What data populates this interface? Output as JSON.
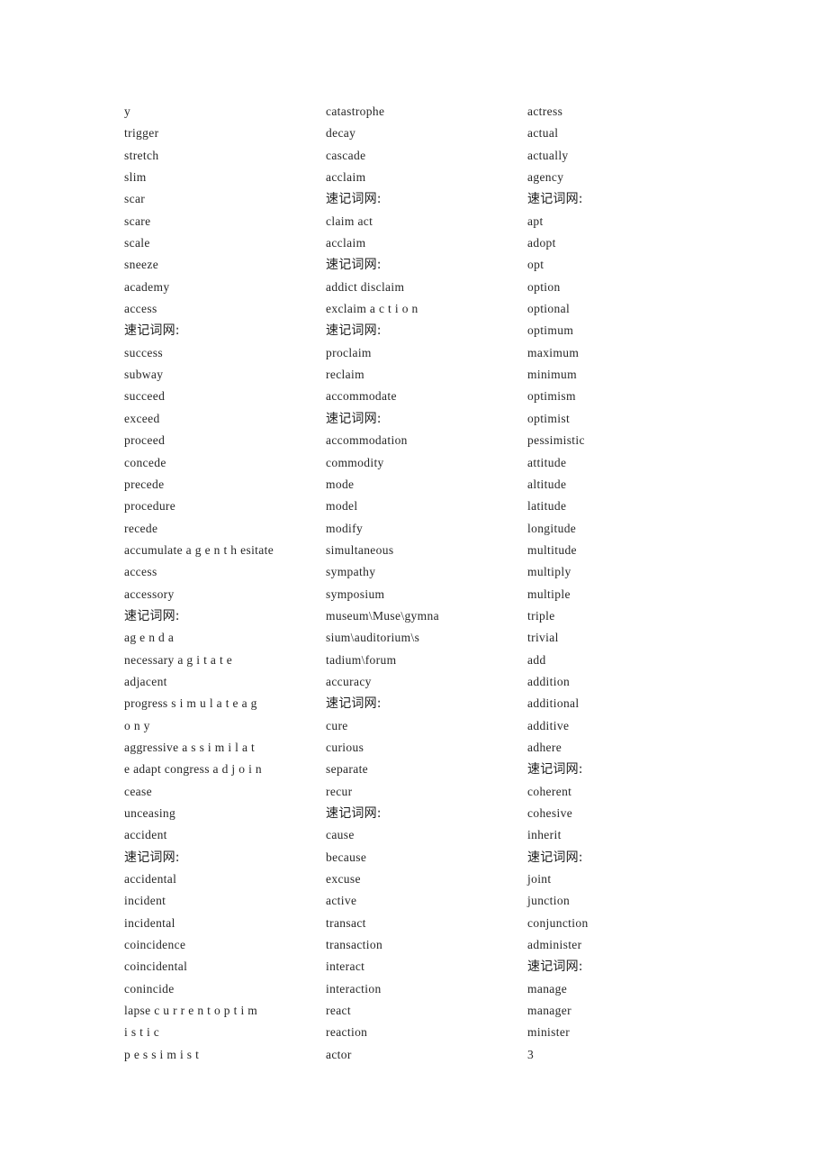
{
  "document": {
    "page_number": "3",
    "shorthand_label": "速记词网:",
    "columns": [
      {
        "name": "column-1",
        "lines": [
          {
            "text": "y",
            "type": "word"
          },
          {
            "text": "trigger",
            "type": "word"
          },
          {
            "text": "stretch",
            "type": "word"
          },
          {
            "text": "slim",
            "type": "word"
          },
          {
            "text": "scar",
            "type": "word"
          },
          {
            "text": "scare",
            "type": "word"
          },
          {
            "text": "scale",
            "type": "word"
          },
          {
            "text": "sneeze",
            "type": "word"
          },
          {
            "text": "academy",
            "type": "word"
          },
          {
            "text": "access",
            "type": "word"
          },
          {
            "text": "速记词网:",
            "type": "cn"
          },
          {
            "text": "success",
            "type": "word"
          },
          {
            "text": "subway",
            "type": "word"
          },
          {
            "text": "succeed",
            "type": "word"
          },
          {
            "text": "exceed",
            "type": "word"
          },
          {
            "text": "proceed",
            "type": "word"
          },
          {
            "text": "concede",
            "type": "word"
          },
          {
            "text": "precede",
            "type": "word"
          },
          {
            "text": "procedure",
            "type": "word"
          },
          {
            "text": "recede",
            "type": "word"
          },
          {
            "text": "accumulate a g e n t h esitate",
            "type": "spread"
          },
          {
            "text": "access",
            "type": "word"
          },
          {
            "text": "accessory",
            "type": "word"
          },
          {
            "text": "速记词网:",
            "type": "cn"
          },
          {
            "text": "ag e n d a",
            "type": "spread"
          },
          {
            "text": "necessary a g i t a t e",
            "type": "spread"
          },
          {
            "text": "adjacent",
            "type": "word"
          },
          {
            "text": "progress s i m u l a t e a g",
            "type": "spread"
          },
          {
            "text": "o n y",
            "type": "spread"
          },
          {
            "text": "aggressive a s s i m i l a t",
            "type": "spread"
          },
          {
            "text": "e adapt congress a d j o i n",
            "type": "spread"
          },
          {
            "text": "cease",
            "type": "word"
          },
          {
            "text": "unceasing",
            "type": "word"
          },
          {
            "text": "accident",
            "type": "word"
          },
          {
            "text": "速记词网:",
            "type": "cn"
          },
          {
            "text": "accidental",
            "type": "word"
          },
          {
            "text": "incident",
            "type": "word"
          },
          {
            "text": "incidental",
            "type": "word"
          },
          {
            "text": "coincidence",
            "type": "word"
          },
          {
            "text": "coincidental",
            "type": "word"
          },
          {
            "text": "conincide",
            "type": "word"
          },
          {
            "text": "lapse c u r r e n t o p t i m",
            "type": "spread"
          },
          {
            "text": "i s t i c",
            "type": "spread"
          },
          {
            "text": "p e s s i m i s t",
            "type": "spread"
          }
        ]
      },
      {
        "name": "column-2",
        "lines": [
          {
            "text": "catastrophe",
            "type": "word"
          },
          {
            "text": "decay",
            "type": "word"
          },
          {
            "text": "cascade",
            "type": "word"
          },
          {
            "text": "acclaim",
            "type": "word"
          },
          {
            "text": "速记词网:",
            "type": "cn"
          },
          {
            "text": "claim act",
            "type": "word"
          },
          {
            "text": "acclaim",
            "type": "word"
          },
          {
            "text": "速记词网:",
            "type": "cn"
          },
          {
            "text": "addict disclaim",
            "type": "word"
          },
          {
            "text": "exclaim a c t i o n",
            "type": "spread"
          },
          {
            "text": "速记词网:",
            "type": "cn"
          },
          {
            "text": "proclaim",
            "type": "word"
          },
          {
            "text": "reclaim",
            "type": "word"
          },
          {
            "text": "accommodate",
            "type": "word"
          },
          {
            "text": "速记词网:",
            "type": "cn"
          },
          {
            "text": "accommodation",
            "type": "word"
          },
          {
            "text": "commodity",
            "type": "word"
          },
          {
            "text": "mode",
            "type": "word"
          },
          {
            "text": "model",
            "type": "word"
          },
          {
            "text": "modify",
            "type": "word"
          },
          {
            "text": "simultaneous",
            "type": "word"
          },
          {
            "text": "sympathy",
            "type": "word"
          },
          {
            "text": "symposium",
            "type": "word"
          },
          {
            "text": "museum\\Muse\\gymna",
            "type": "word"
          },
          {
            "text": "sium\\auditorium\\s",
            "type": "word"
          },
          {
            "text": "tadium\\forum",
            "type": "word"
          },
          {
            "text": "accuracy",
            "type": "word"
          },
          {
            "text": "速记词网:",
            "type": "cn"
          },
          {
            "text": "cure",
            "type": "word"
          },
          {
            "text": "curious",
            "type": "word"
          },
          {
            "text": "separate",
            "type": "word"
          },
          {
            "text": "recur",
            "type": "word"
          },
          {
            "text": "速记词网:",
            "type": "cn"
          },
          {
            "text": "cause",
            "type": "word"
          },
          {
            "text": "because",
            "type": "word"
          },
          {
            "text": "excuse",
            "type": "word"
          },
          {
            "text": "active",
            "type": "word"
          },
          {
            "text": "transact",
            "type": "word"
          },
          {
            "text": "transaction",
            "type": "word"
          },
          {
            "text": "interact",
            "type": "word"
          },
          {
            "text": "interaction",
            "type": "word"
          },
          {
            "text": "react",
            "type": "word"
          },
          {
            "text": "reaction",
            "type": "word"
          },
          {
            "text": "actor",
            "type": "word"
          }
        ]
      },
      {
        "name": "column-3",
        "lines": [
          {
            "text": "actress",
            "type": "word"
          },
          {
            "text": "actual",
            "type": "word"
          },
          {
            "text": "actually",
            "type": "word"
          },
          {
            "text": "agency",
            "type": "word"
          },
          {
            "text": "速记词网:",
            "type": "cn"
          },
          {
            "text": "apt",
            "type": "word"
          },
          {
            "text": "adopt",
            "type": "word"
          },
          {
            "text": "opt",
            "type": "word"
          },
          {
            "text": "option",
            "type": "word"
          },
          {
            "text": "optional",
            "type": "word"
          },
          {
            "text": "optimum",
            "type": "word"
          },
          {
            "text": "maximum",
            "type": "word"
          },
          {
            "text": "minimum",
            "type": "word"
          },
          {
            "text": "optimism",
            "type": "word"
          },
          {
            "text": "optimist",
            "type": "word"
          },
          {
            "text": "pessimistic",
            "type": "word"
          },
          {
            "text": "attitude",
            "type": "word"
          },
          {
            "text": "altitude",
            "type": "word"
          },
          {
            "text": "latitude",
            "type": "word"
          },
          {
            "text": "longitude",
            "type": "word"
          },
          {
            "text": "multitude",
            "type": "word"
          },
          {
            "text": "multiply",
            "type": "word"
          },
          {
            "text": "multiple",
            "type": "word"
          },
          {
            "text": "triple",
            "type": "word"
          },
          {
            "text": "trivial",
            "type": "word"
          },
          {
            "text": "add",
            "type": "word"
          },
          {
            "text": "addition",
            "type": "word"
          },
          {
            "text": "additional",
            "type": "word"
          },
          {
            "text": "additive",
            "type": "word"
          },
          {
            "text": "adhere",
            "type": "word"
          },
          {
            "text": "速记词网:",
            "type": "cn"
          },
          {
            "text": "coherent",
            "type": "word"
          },
          {
            "text": "cohesive",
            "type": "word"
          },
          {
            "text": "inherit",
            "type": "word"
          },
          {
            "text": "速记词网:",
            "type": "cn"
          },
          {
            "text": "joint",
            "type": "word"
          },
          {
            "text": "junction",
            "type": "word"
          },
          {
            "text": "conjunction",
            "type": "word"
          },
          {
            "text": "administer",
            "type": "word"
          },
          {
            "text": "速记词网:",
            "type": "cn"
          },
          {
            "text": "manage",
            "type": "word"
          },
          {
            "text": "manager",
            "type": "word"
          },
          {
            "text": "minister",
            "type": "word"
          },
          {
            "text": "3",
            "type": "word"
          }
        ]
      }
    ]
  }
}
